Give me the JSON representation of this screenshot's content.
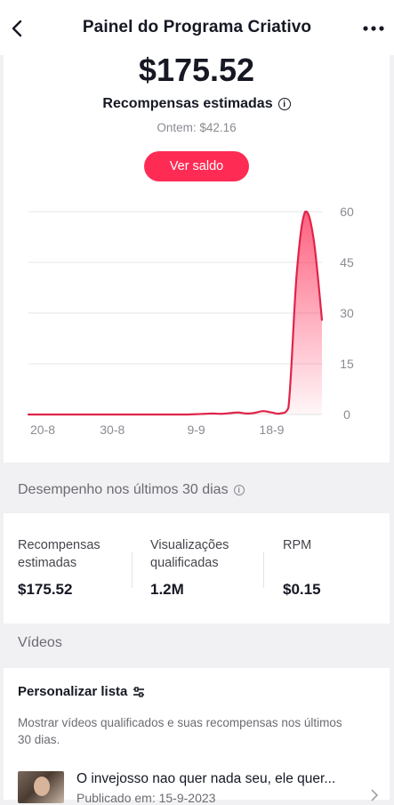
{
  "header": {
    "title": "Painel do Programa Criativo"
  },
  "summary": {
    "amount": "$175.52",
    "label": "Recompensas estimadas",
    "info_symbol": "i",
    "yesterday": "Ontem: $42.16",
    "button_label": "Ver saldo"
  },
  "chart_data": {
    "type": "area",
    "x_ticks": [
      "20-8",
      "30-8",
      "9-9",
      "18-9"
    ],
    "y_ticks": [
      0,
      15,
      30,
      45,
      60
    ],
    "ylim": [
      0,
      60
    ],
    "x_days": [
      0,
      1,
      2,
      3,
      4,
      5,
      6,
      7,
      8,
      9,
      10,
      11,
      12,
      13,
      14,
      15,
      16,
      17,
      18,
      19,
      20,
      21,
      22,
      23,
      24,
      25,
      26,
      27,
      28,
      29,
      30,
      31,
      32,
      33,
      34,
      35
    ],
    "values": [
      0,
      0,
      0,
      0,
      0,
      0,
      0,
      0,
      0,
      0,
      0,
      0,
      0,
      0,
      0,
      0,
      0,
      0,
      0,
      0,
      0.1,
      0.2,
      0.3,
      0.2,
      0.4,
      0.6,
      0.3,
      0.5,
      1.0,
      0.6,
      0.3,
      2,
      42,
      60,
      52,
      28
    ],
    "color": "#fe2c55"
  },
  "performance": {
    "section_title": "Desempenho nos últimos 30 dias",
    "stats": [
      {
        "label": "Recompensas\nestimadas",
        "value": "$175.52"
      },
      {
        "label": "Visualizações\nqualificadas",
        "value": "1.2M"
      },
      {
        "label": "RPM",
        "value": "$0.15"
      }
    ]
  },
  "videos": {
    "section_title": "Vídeos",
    "list_title": "Personalizar lista",
    "description": "Mostrar vídeos qualificados e suas recompensas nos últimos 30 dias.",
    "item": {
      "title": "O invejosso nao quer nada seu, ele quer...",
      "date": "Publicado em: 15-9-2023"
    }
  },
  "colors": {
    "accent": "#fe2c55",
    "background": "#f1f1f3"
  }
}
